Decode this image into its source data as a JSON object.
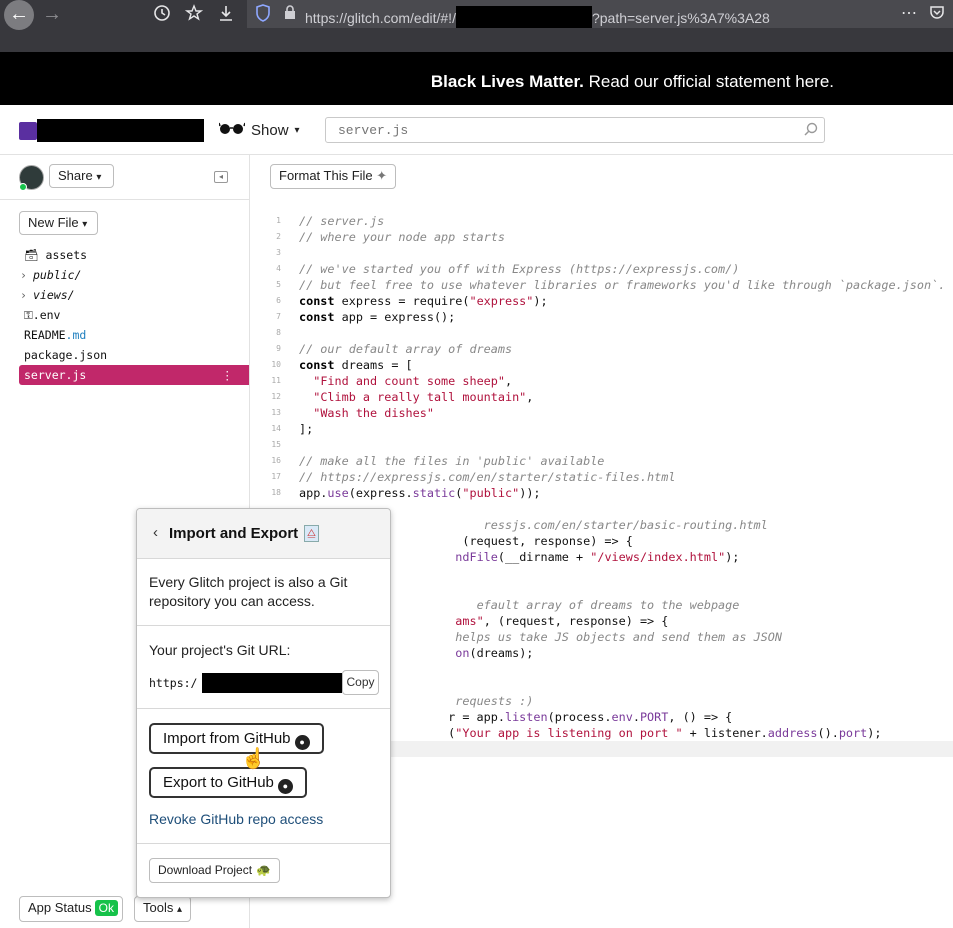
{
  "browser": {
    "back": "←",
    "forward": "→",
    "url_prefix": "https://glitch.com/edit/#!/",
    "url_suffix": "?path=server.js%3A7%3A28",
    "icons": [
      "history-icon",
      "bookmark-star-icon",
      "download-icon",
      "shield-icon",
      "lock-icon",
      "more-icon",
      "pocket-icon"
    ]
  },
  "banner": {
    "bold": "Black Lives Matter.",
    "text": " Read our official statement here."
  },
  "header": {
    "show_label": "Show",
    "search_placeholder": "server.js"
  },
  "sidebar": {
    "share_label": "Share",
    "new_file_label": "New File",
    "files": [
      {
        "name": "assets",
        "type": "assets"
      },
      {
        "name": "public/",
        "type": "folder"
      },
      {
        "name": "views/",
        "type": "folder"
      },
      {
        "name": ".env",
        "type": "env"
      },
      {
        "name": "README",
        "ext": ".md",
        "type": "file"
      },
      {
        "name": "package.json",
        "type": "file"
      },
      {
        "name": "server.js",
        "type": "active"
      }
    ],
    "app_status_label": "App Status",
    "ok_label": "Ok",
    "tools_label": "Tools"
  },
  "editor": {
    "format_label": "Format This File",
    "line_numbers": [
      "1",
      "2",
      "3",
      "4",
      "5",
      "6",
      "7",
      "8",
      "9",
      "10",
      "11",
      "12",
      "13",
      "14",
      "15",
      "16",
      "17",
      "18",
      "",
      "",
      "",
      "",
      "",
      "",
      "",
      "",
      "",
      "",
      "",
      "",
      "",
      "",
      "",
      "",
      ""
    ]
  },
  "popover": {
    "title": "Import and Export",
    "description": "Every Glitch project is also a Git repository you can access.",
    "git_url_label": "Your project's Git URL:",
    "git_url_prefix": "https:/",
    "copy_label": "Copy",
    "import_label": "Import from GitHub",
    "export_label": "Export to GitHub",
    "revoke_label": "Revoke GitHub repo access",
    "download_label": "Download Project"
  },
  "colors": {
    "active_file": "#c1286a",
    "ok_badge": "#16c24a",
    "banner_bg": "#000000"
  }
}
